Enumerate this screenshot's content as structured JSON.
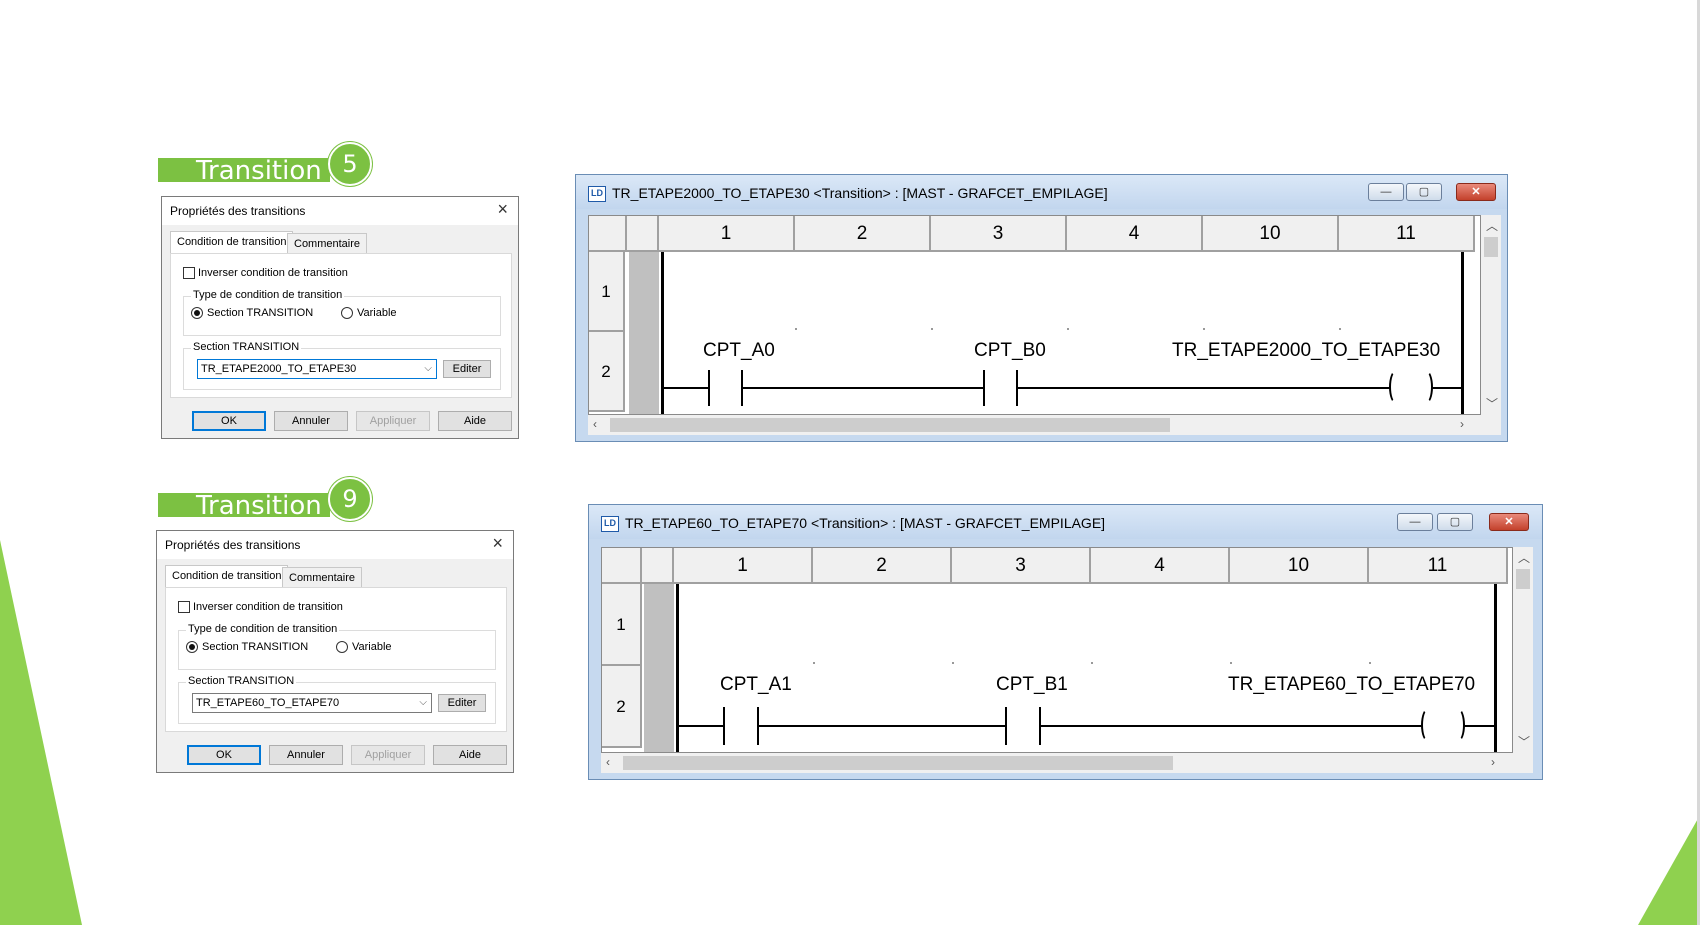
{
  "colors": {
    "accent_green": "#7cc142"
  },
  "transitions": [
    {
      "banner": {
        "label": "Transition",
        "number": "5"
      },
      "dialog": {
        "title": "Propriétés des transitions",
        "tabs": [
          "Condition de transition",
          "Commentaire"
        ],
        "invert_label": "Inverser condition de transition",
        "type_group_label": "Type de condition de transition",
        "radio_section": "Section TRANSITION",
        "radio_variable": "Variable",
        "section_label": "Section TRANSITION",
        "section_value": "TR_ETAPE2000_TO_ETAPE30",
        "edit_button": "Editer",
        "buttons": {
          "ok": "OK",
          "cancel": "Annuler",
          "apply": "Appliquer",
          "help": "Aide"
        }
      },
      "ladder": {
        "title": "TR_ETAPE2000_TO_ETAPE30 <Transition> : [MAST - GRAFCET_EMPILAGE]",
        "columns": [
          "1",
          "2",
          "3",
          "4",
          "10",
          "11"
        ],
        "rows": [
          "1",
          "2"
        ],
        "contact_a": "CPT_A0",
        "contact_b": "CPT_B0",
        "coil": "TR_ETAPE2000_TO_ETAPE30"
      }
    },
    {
      "banner": {
        "label": "Transition",
        "number": "9"
      },
      "dialog": {
        "title": "Propriétés des transitions",
        "tabs": [
          "Condition de transition",
          "Commentaire"
        ],
        "invert_label": "Inverser condition de transition",
        "type_group_label": "Type de condition de transition",
        "radio_section": "Section TRANSITION",
        "radio_variable": "Variable",
        "section_label": "Section TRANSITION",
        "section_value": "TR_ETAPE60_TO_ETAPE70",
        "edit_button": "Editer",
        "buttons": {
          "ok": "OK",
          "cancel": "Annuler",
          "apply": "Appliquer",
          "help": "Aide"
        }
      },
      "ladder": {
        "title": "TR_ETAPE60_TO_ETAPE70 <Transition> : [MAST - GRAFCET_EMPILAGE]",
        "columns": [
          "1",
          "2",
          "3",
          "4",
          "10",
          "11"
        ],
        "rows": [
          "1",
          "2"
        ],
        "contact_a": "CPT_A1",
        "contact_b": "CPT_B1",
        "coil": "TR_ETAPE60_TO_ETAPE70"
      }
    }
  ]
}
